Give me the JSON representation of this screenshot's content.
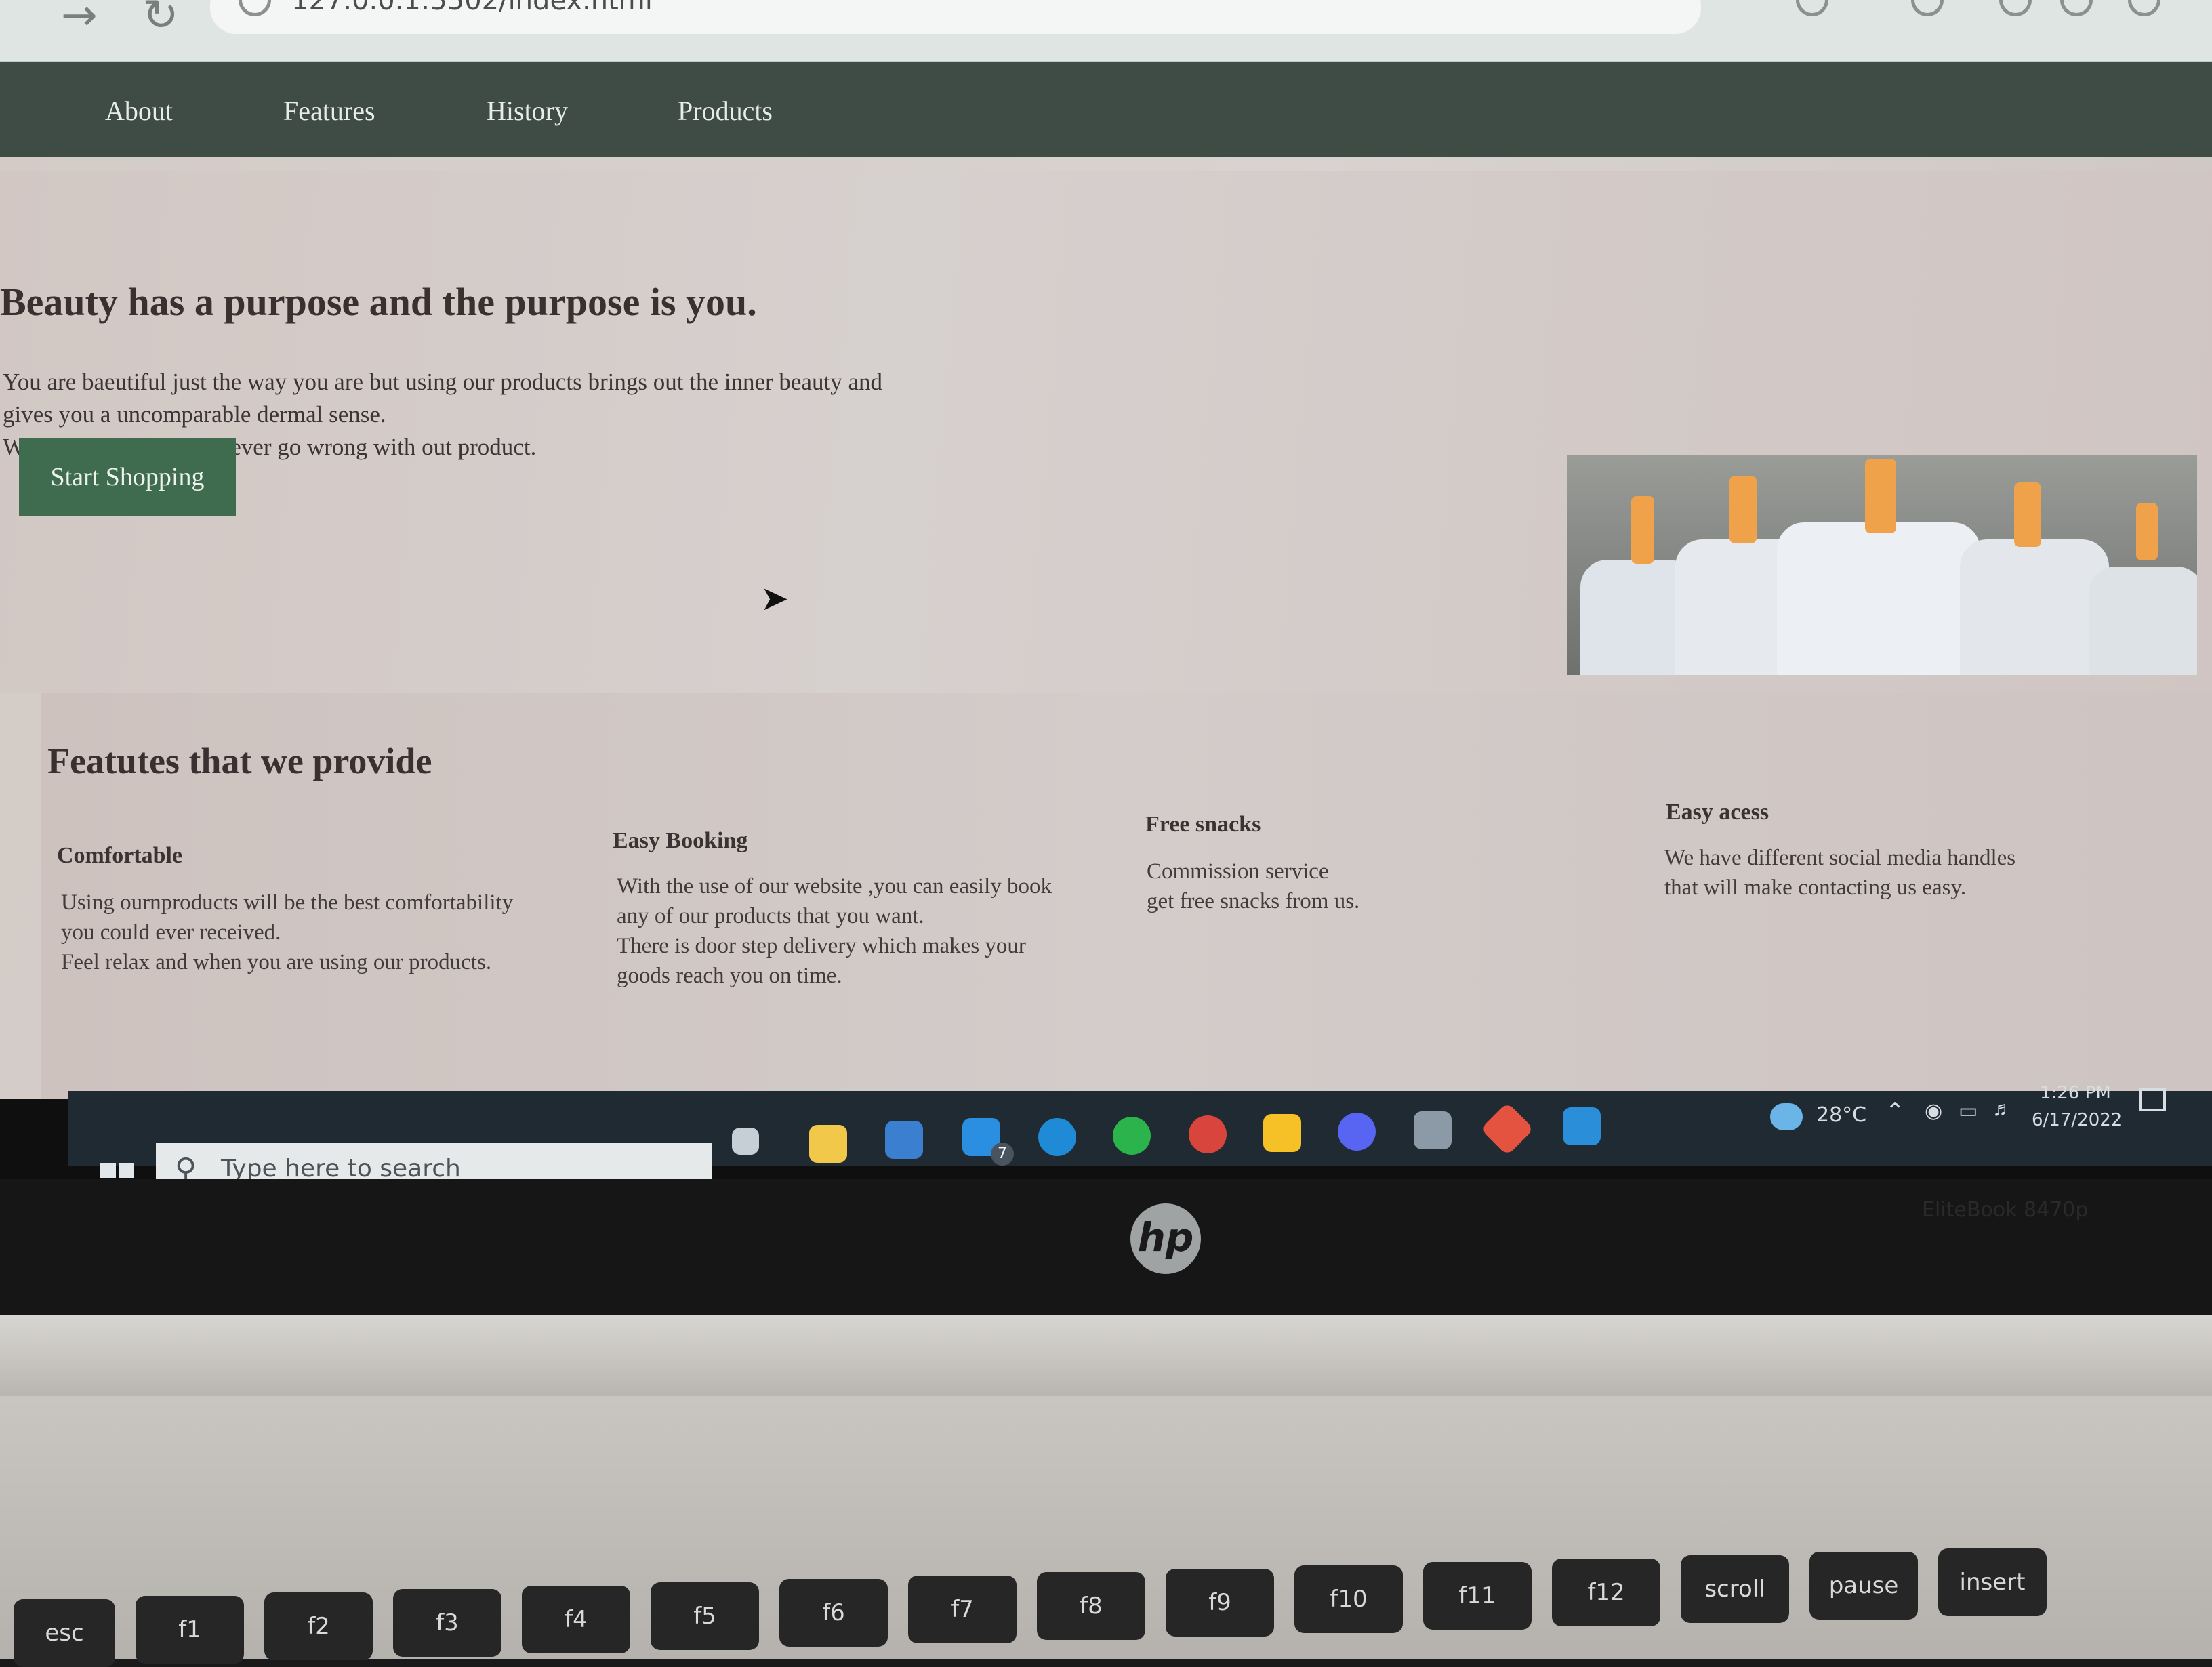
{
  "browser": {
    "url": "127.0.0.1:5502/index.html"
  },
  "nav": {
    "items": [
      {
        "label": "About"
      },
      {
        "label": "Features"
      },
      {
        "label": "History"
      },
      {
        "label": "Products"
      }
    ]
  },
  "hero": {
    "headline": "Beauty has a purpose and the purpose is you.",
    "intro_lines": [
      "You are baeutiful just the way you are but using our products brings out the inner beauty and",
      "gives you a uncomparable dermal sense.",
      "Which means you can never go wrong with out product."
    ],
    "cta_label": "Start Shopping"
  },
  "features": {
    "title": "Featutes that we provide",
    "items": [
      {
        "title": "Comfortable",
        "lines": [
          "Using ournproducts will be the best comfortability",
          "you could ever received.",
          "Feel relax and when you are using our products."
        ]
      },
      {
        "title": "Easy Booking",
        "lines": [
          "With the use of our website ,you can easily book",
          "any of our products that you want.",
          "There is door step delivery which makes your",
          "goods reach you on time."
        ]
      },
      {
        "title": "Free snacks",
        "lines": [
          "Commission service",
          "get free snacks from us."
        ]
      },
      {
        "title": "Easy acess",
        "lines": [
          "We have different social media handles",
          "that will make contacting us easy."
        ]
      }
    ]
  },
  "taskbar": {
    "search_placeholder": "Type here to search",
    "mail_badge": "7",
    "temperature": "28°C",
    "time": "1:26 PM",
    "date": "6/17/2022",
    "apps": [
      "task-view-icon",
      "file-explorer-icon",
      "store-icon",
      "mail-icon",
      "edge-icon",
      "whatsapp-icon",
      "chrome-icon",
      "google-drive-icon",
      "discord-icon",
      "app-icon",
      "git-icon",
      "vscode-icon"
    ]
  },
  "laptop": {
    "brand": "hp",
    "model": "EliteBook 8470p",
    "keys": [
      "esc",
      "f1",
      "f2",
      "f3",
      "f4",
      "f5",
      "f6",
      "f7",
      "f8",
      "f9",
      "f10",
      "f11",
      "f12",
      "scroll",
      "pause",
      "insert"
    ]
  },
  "colors": {
    "nav_bg": "#3f4c45",
    "cta_bg": "#3f6b4e",
    "page_bg": "#d4cbc6",
    "taskbar_bg": "#202a33"
  }
}
